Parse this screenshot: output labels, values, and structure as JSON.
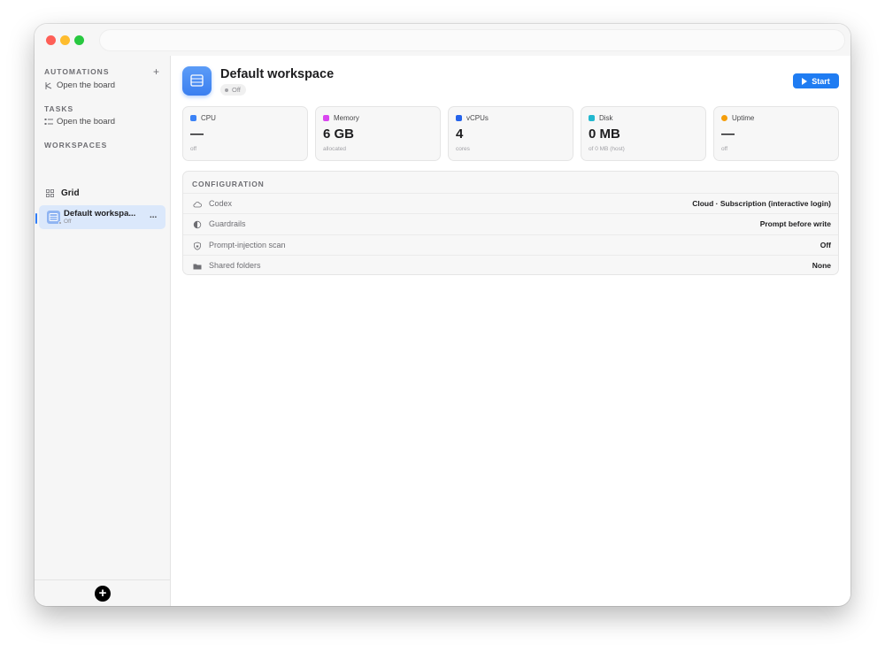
{
  "sidebar": {
    "automations": {
      "title": "AUTOMATIONS",
      "item": "Open the board"
    },
    "tasks": {
      "title": "TASKS",
      "item": "Open the board"
    },
    "workspaces": {
      "title": "WORKSPACES",
      "grid_label": "Grid",
      "active": {
        "name": "Default workspa...",
        "status": "Off",
        "more": "..."
      }
    },
    "add": "+"
  },
  "workspace": {
    "title": "Default workspace",
    "status": "Off",
    "start_label": "Start"
  },
  "metrics": [
    {
      "label": "CPU",
      "value": "—",
      "sub": "off",
      "color": "#3b82f6",
      "icon": "cpu-icon"
    },
    {
      "label": "Memory",
      "value": "6 GB",
      "sub": "allocated",
      "color": "#d946ef",
      "icon": "memory-icon"
    },
    {
      "label": "vCPUs",
      "value": "4",
      "sub": "cores",
      "color": "#2563eb",
      "icon": "vcpu-icon"
    },
    {
      "label": "Disk",
      "value": "0 MB",
      "sub": "of 0 MB (host)",
      "color": "#22b8cf",
      "icon": "disk-icon"
    },
    {
      "label": "Uptime",
      "value": "—",
      "sub": "off",
      "color": "#f59e0b",
      "icon": "uptime-icon"
    }
  ],
  "configuration": {
    "title": "CONFIGURATION",
    "rows": [
      {
        "label": "Codex",
        "value": "Cloud · Subscription (interactive login)",
        "icon": "cloud-icon"
      },
      {
        "label": "Guardrails",
        "value": "Prompt before write",
        "icon": "shield-half-icon"
      },
      {
        "label": "Prompt-injection scan",
        "value": "Off",
        "icon": "shield-lock-icon"
      },
      {
        "label": "Shared folders",
        "value": "None",
        "icon": "folder-icon"
      }
    ]
  }
}
